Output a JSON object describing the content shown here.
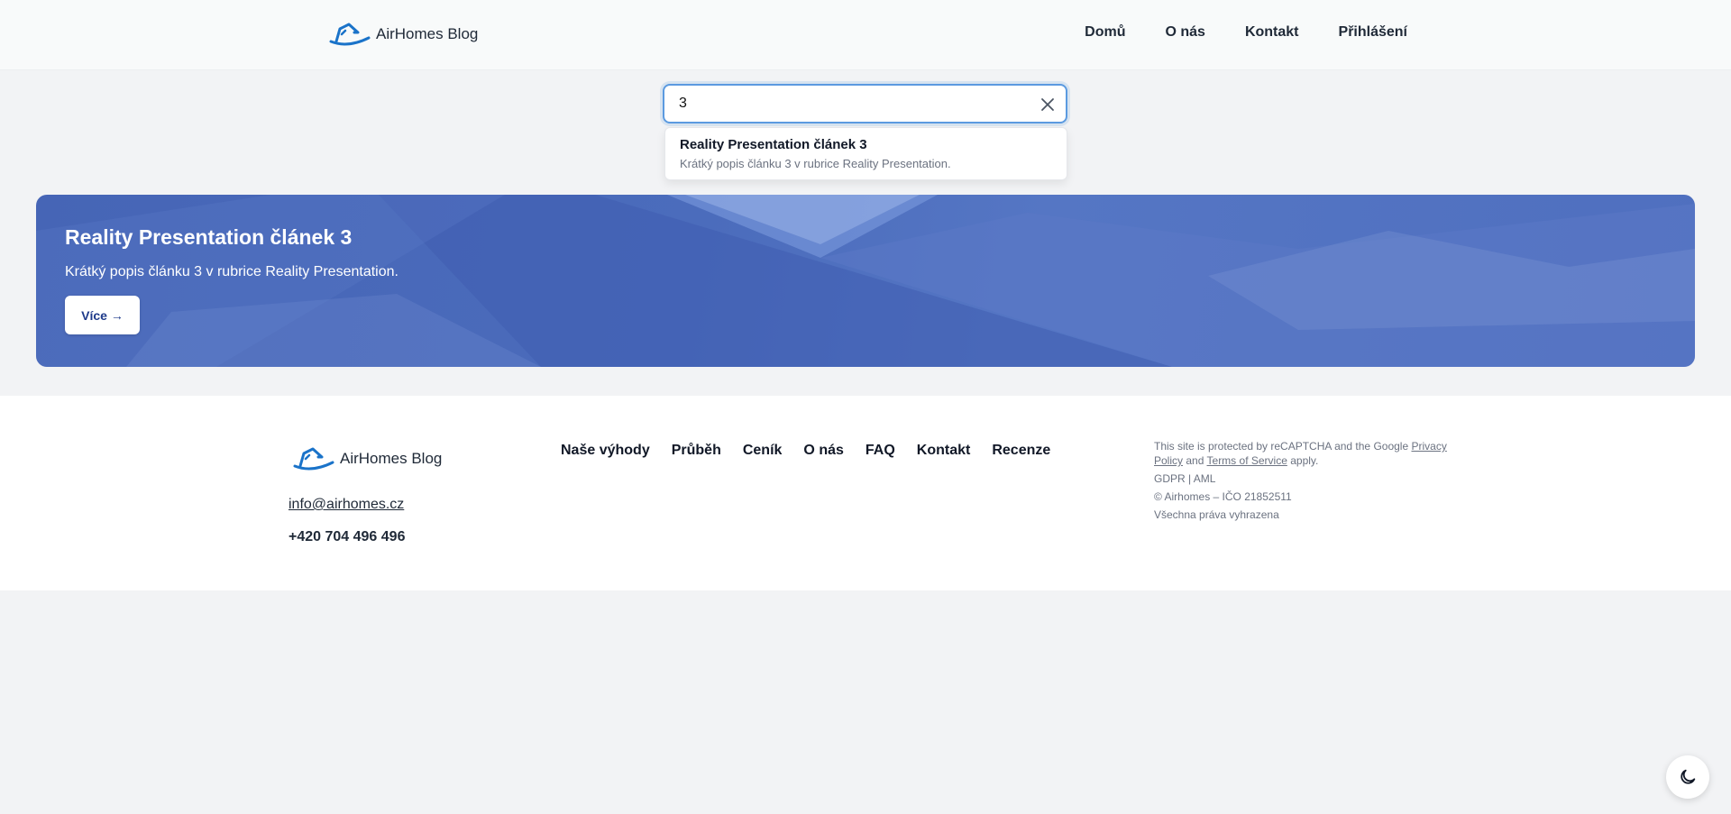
{
  "header": {
    "brand": "AirHomes Blog",
    "nav": [
      "Domů",
      "O nás",
      "Kontakt",
      "Přihlášení"
    ]
  },
  "search": {
    "value": "3",
    "placeholder": "",
    "results": [
      {
        "title": "Reality Presentation článek 3",
        "description": "Krátký popis článku 3 v rubrice Reality Presentation."
      }
    ]
  },
  "hero": {
    "title": "Reality Presentation článek 3",
    "description": "Krátký popis článku 3 v rubrice Reality Presentation.",
    "button": "Více →"
  },
  "footer": {
    "brand": "AirHomes Blog",
    "email": "info@airhomes.cz",
    "phone": "+420 704 496 496",
    "nav": [
      "Naše výhody",
      "Průběh",
      "Ceník",
      "O nás",
      "FAQ",
      "Kontakt",
      "Recenze"
    ],
    "legal": {
      "recaptcha_prefix": "This site is protected by reCAPTCHA and the Google",
      "privacy_link": "Privacy Policy",
      "and": "and",
      "terms_link": "Terms of Service",
      "apply": "apply.",
      "gdpr": "GDPR | AML",
      "copyright": "© Airhomes – IČO 21852511",
      "rights": "Všechna práva vyhrazena"
    }
  },
  "icons": {
    "brand": "house-logo-icon",
    "clear": "close-icon",
    "theme": "moon-icon"
  },
  "colors": {
    "accent": "#1a73c9",
    "hero": "#4a6bbd",
    "focus": "#5b9ae0"
  }
}
